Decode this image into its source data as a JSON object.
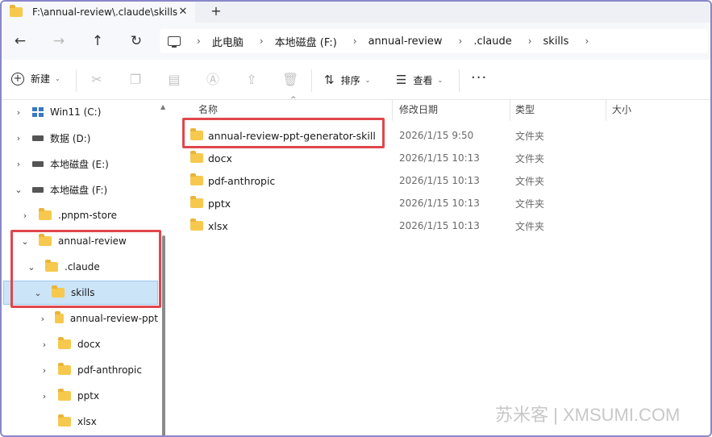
{
  "tab": {
    "title": "F:\\annual-review\\.claude\\skills",
    "close": "✕",
    "add": "+"
  },
  "nav": {
    "back": "←",
    "forward": "→",
    "up": "↑",
    "refresh": "↻"
  },
  "breadcrumb": [
    "此电脑",
    "本地磁盘 (F:)",
    "annual-review",
    ".claude",
    "skills"
  ],
  "toolbar": {
    "new_label": "新建",
    "sort_label": "排序",
    "view_label": "查看",
    "more": "···",
    "icons": [
      "cut-icon",
      "copy-icon",
      "paste-icon",
      "rename-icon",
      "share-icon",
      "delete-icon"
    ]
  },
  "sidebar": {
    "items": [
      {
        "label": "Win11 (C:)",
        "chevron": "›",
        "icon": "windows-drive-icon"
      },
      {
        "label": "数据 (D:)",
        "chevron": "›",
        "icon": "drive-icon"
      },
      {
        "label": "本地磁盘 (E:)",
        "chevron": "›",
        "icon": "drive-icon"
      },
      {
        "label": "本地磁盘 (F:)",
        "chevron": "⌄",
        "icon": "drive-icon"
      },
      {
        "label": ".pnpm-store",
        "chevron": "›",
        "icon": "folder-icon"
      },
      {
        "label": "annual-review",
        "chevron": "⌄",
        "icon": "folder-icon"
      },
      {
        "label": ".claude",
        "chevron": "⌄",
        "icon": "folder-icon"
      },
      {
        "label": "skills",
        "chevron": "⌄",
        "icon": "folder-icon"
      },
      {
        "label": "annual-review-ppt",
        "chevron": "›",
        "icon": "folder-icon"
      },
      {
        "label": "docx",
        "chevron": "›",
        "icon": "folder-icon"
      },
      {
        "label": "pdf-anthropic",
        "chevron": "›",
        "icon": "folder-icon"
      },
      {
        "label": "pptx",
        "chevron": "›",
        "icon": "folder-icon"
      },
      {
        "label": "xlsx",
        "chevron": "",
        "icon": "folder-icon"
      }
    ]
  },
  "columns": {
    "name": "名称",
    "modified": "修改日期",
    "type": "类型",
    "size": "大小"
  },
  "files": [
    {
      "name": "annual-review-ppt-generator-skill",
      "modified": "2026/1/15 9:50",
      "type": "文件夹"
    },
    {
      "name": "docx",
      "modified": "2026/1/15 10:13",
      "type": "文件夹"
    },
    {
      "name": "pdf-anthropic",
      "modified": "2026/1/15 10:13",
      "type": "文件夹"
    },
    {
      "name": "pptx",
      "modified": "2026/1/15 10:13",
      "type": "文件夹"
    },
    {
      "name": "xlsx",
      "modified": "2026/1/15 10:13",
      "type": "文件夹"
    }
  ],
  "watermark": "苏米客 | XMSUMI.COM",
  "colors": {
    "highlight": "#e0474c",
    "selection": "#cce4f7",
    "folder": "#f6c94e",
    "window_border": "#8a87c9"
  }
}
